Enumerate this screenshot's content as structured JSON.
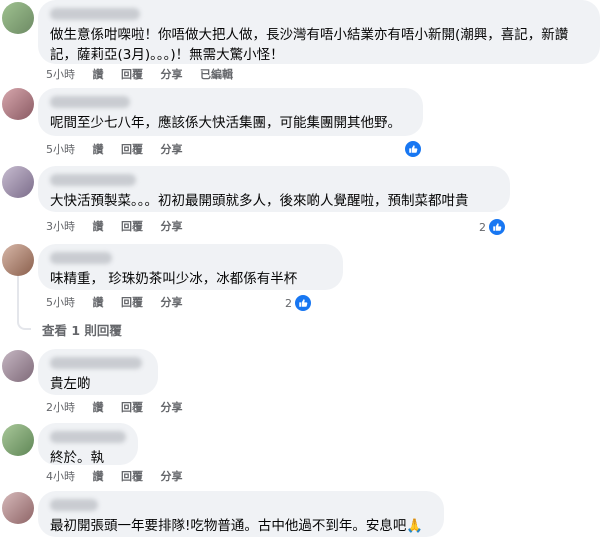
{
  "comments": [
    {
      "text": "做生意係咁㗎啦！你唔做大把人做，長沙灣有唔小結業亦有唔小新開(潮興，喜記，新讚記，薩莉亞(3月)。。。)！無需大驚小怪！",
      "time": "5小時",
      "like_label": "讚",
      "reply_label": "回覆",
      "share_label": "分享",
      "edited_label": "已編輯"
    },
    {
      "text": "呢間至少七八年，應該係大快活集團，可能集團開其他野。",
      "time": "5小時",
      "like_label": "讚",
      "reply_label": "回覆",
      "share_label": "分享",
      "reaction_count": ""
    },
    {
      "text": "大快活預製菜。。。初初最開頭就多人，後來啲人覺醒啦，預制菜都咁貴",
      "time": "3小時",
      "like_label": "讚",
      "reply_label": "回覆",
      "share_label": "分享",
      "reaction_count": "2"
    },
    {
      "text": "味精重， 珍珠奶茶叫少冰，冰都係有半杯",
      "time": "5小時",
      "like_label": "讚",
      "reply_label": "回覆",
      "share_label": "分享",
      "reaction_count": "2"
    },
    {
      "text": "貴左啲",
      "time": "2小時",
      "like_label": "讚",
      "reply_label": "回覆",
      "share_label": "分享"
    },
    {
      "text": "終於。執",
      "time": "4小時",
      "like_label": "讚",
      "reply_label": "回覆",
      "share_label": "分享"
    },
    {
      "text": "最初開張頭一年要排隊!吃物普通。古中他過不到年。安息吧🙏"
    }
  ],
  "view_replies_label": "查看 1 則回覆",
  "colors": {
    "bubble": "#f0f2f5",
    "meta": "#65676b",
    "like_blue": "#1877f2"
  },
  "icons": [
    "like-reaction-icon"
  ]
}
